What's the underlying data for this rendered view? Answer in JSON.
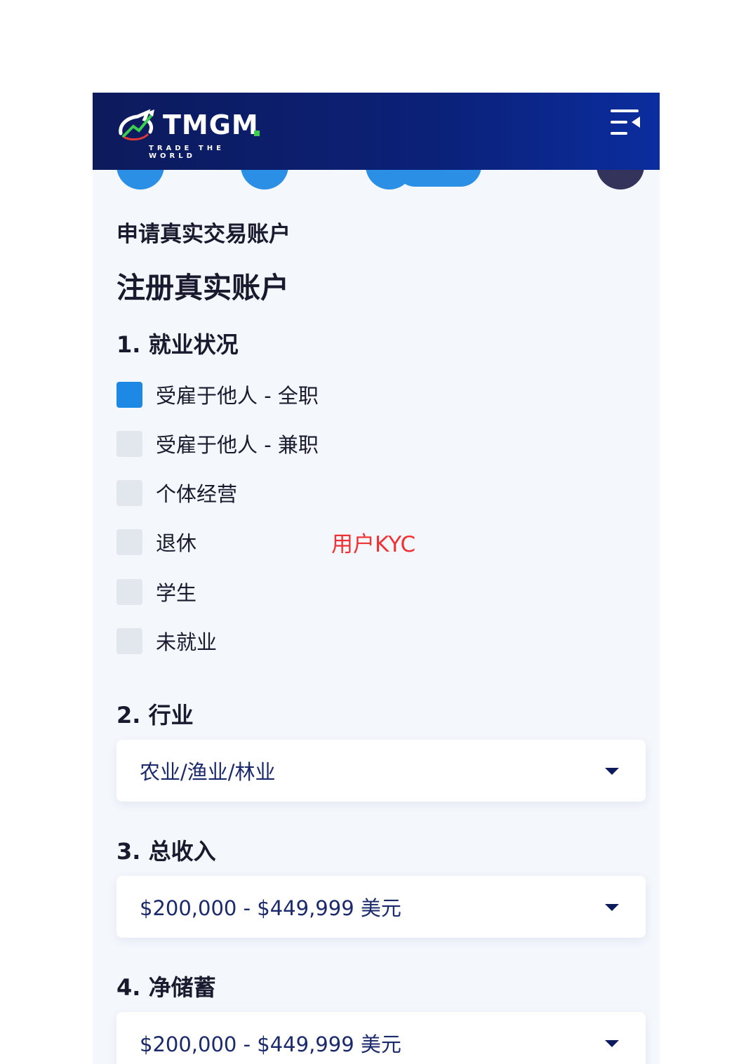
{
  "header": {
    "brand": "TMGM",
    "tagline": "TRADE THE WORLD",
    "menu_icon": "menu-collapse-icon"
  },
  "page": {
    "subtitle": "申请真实交易账户",
    "title": "注册真实账户"
  },
  "employment": {
    "title": "1. 就业状况",
    "options": [
      {
        "label": "受雇于他人 - 全职",
        "checked": true
      },
      {
        "label": "受雇于他人 - 兼职",
        "checked": false
      },
      {
        "label": "个体经营",
        "checked": false
      },
      {
        "label": "退休",
        "checked": false
      },
      {
        "label": "学生",
        "checked": false
      },
      {
        "label": "未就业",
        "checked": false
      }
    ]
  },
  "watermark": "用户KYC",
  "industry": {
    "title": "2. 行业",
    "value": "农业/渔业/林业"
  },
  "income": {
    "title": "3. 总收入",
    "value": "$200,000 - $449,999 美元"
  },
  "savings": {
    "title": "4. 净储蓄",
    "value": "$200,000 - $449,999 美元"
  },
  "colors": {
    "header_dark": "#0d1a5c",
    "accent_blue": "#1e88e5",
    "brand_green": "#3ccf4e",
    "watermark_red": "#f03232"
  }
}
